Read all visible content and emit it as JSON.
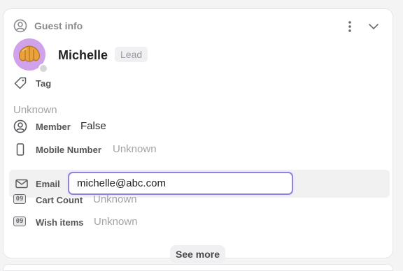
{
  "header": {
    "title": "Guest info"
  },
  "profile": {
    "name": "Michelle",
    "badge": "Lead"
  },
  "tag": {
    "label": "Tag",
    "value": "Unknown"
  },
  "fields": {
    "member": {
      "label": "Member",
      "value": "False"
    },
    "mobile": {
      "label": "Mobile Number",
      "value": "Unknown"
    },
    "email": {
      "label": "Email",
      "value": "michelle@abc.com"
    },
    "cart": {
      "label": "Cart Count",
      "value": "Unknown",
      "icon_text": "09"
    },
    "wish": {
      "label": "Wish items",
      "value": "Unknown",
      "icon_text": "09"
    }
  },
  "see_more": "See more",
  "colors": {
    "avatar_bg": "#cfa2ea",
    "focus_border": "#8e86d8",
    "muted": "#a3a3a8"
  },
  "icons": [
    "user-circle-icon",
    "more-vertical-icon",
    "chevron-down-icon",
    "croissant-icon",
    "tag-icon",
    "smartphone-icon",
    "mail-icon",
    "number-icon"
  ]
}
